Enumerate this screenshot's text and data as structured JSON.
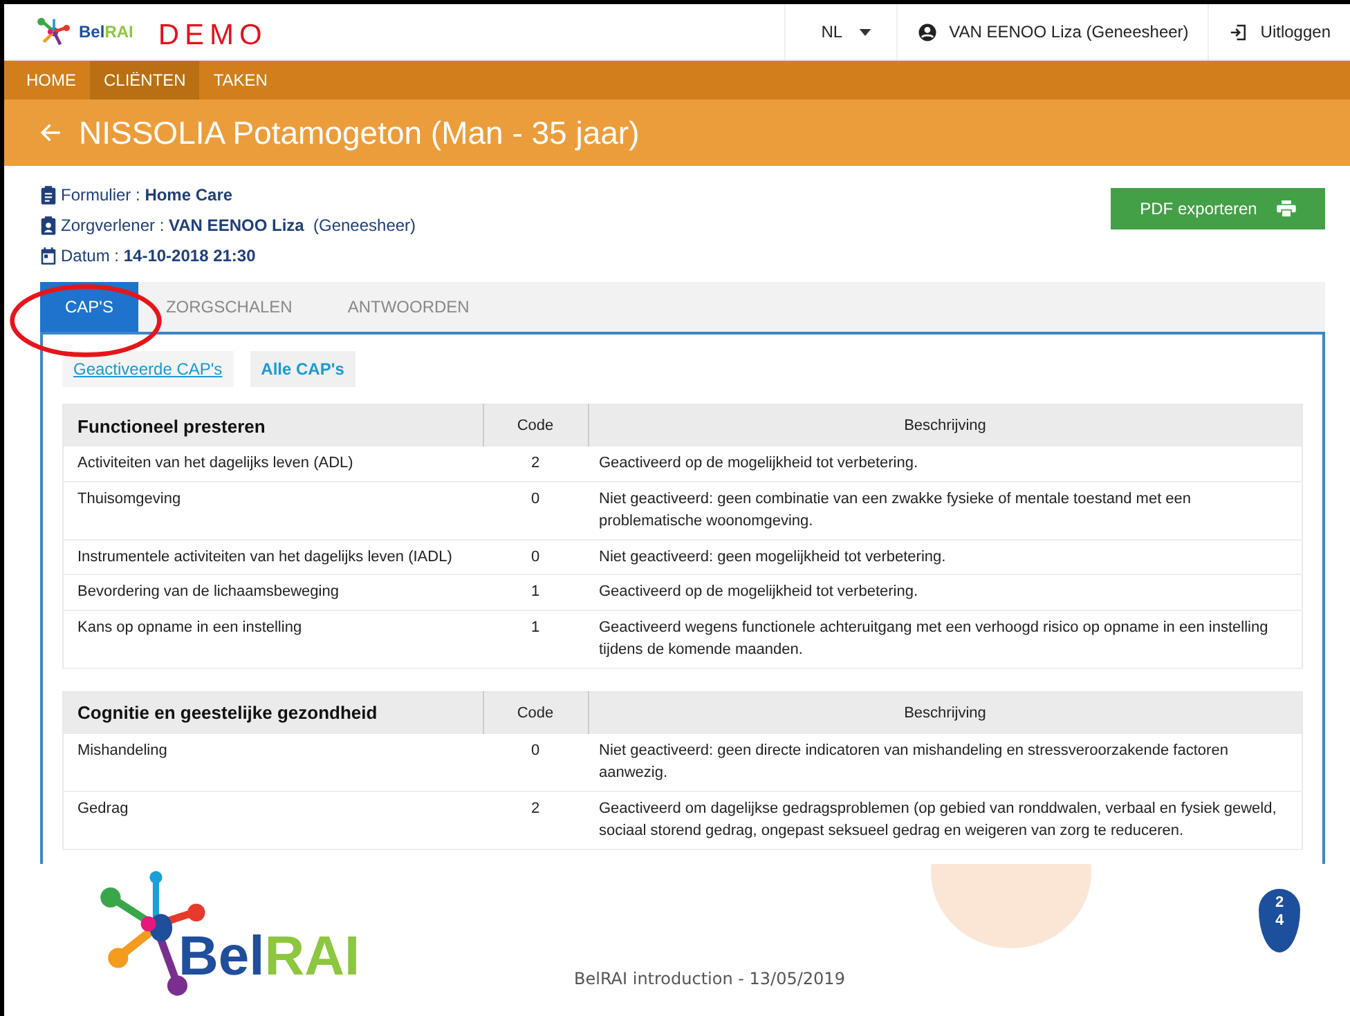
{
  "header": {
    "logo_first": "Bel",
    "logo_second": "RAI",
    "demo_label": "DEMO",
    "language": "NL",
    "user": "VAN EENOO Liza (Geneesheer)",
    "logout": "Uitloggen"
  },
  "nav": [
    {
      "label": "HOME",
      "selected": false
    },
    {
      "label": "CLIËNTEN",
      "selected": true
    },
    {
      "label": "TAKEN",
      "selected": false
    }
  ],
  "client_title": "NISSOLIA Potamogeton (Man - 35 jaar)",
  "info": [
    {
      "kind": "form",
      "label": "Formulier :",
      "value": "Home Care"
    },
    {
      "kind": "person",
      "label": "Zorgverlener :",
      "value": "VAN EENOO Liza",
      "extra": "(Geneesheer)"
    },
    {
      "kind": "date",
      "label": "Datum :",
      "value": "14-10-2018 21:30"
    }
  ],
  "export_button": "PDF exporteren",
  "tabs": [
    {
      "label": "CAP'S",
      "selected": true
    },
    {
      "label": "ZORGSCHALEN",
      "selected": false
    },
    {
      "label": "ANTWOORDEN",
      "selected": false
    }
  ],
  "subtabs": [
    {
      "label": "Geactiveerde CAP's",
      "selected": false
    },
    {
      "label": "Alle CAP's",
      "selected": true
    }
  ],
  "sections": [
    {
      "title": "Functioneel presteren",
      "code_header": "Code",
      "description_header": "Beschrijving",
      "rows": [
        {
          "name": "Activiteiten van het dagelijks leven (ADL)",
          "code": "2",
          "description": "Geactiveerd op de mogelijkheid tot verbetering."
        },
        {
          "name": "Thuisomgeving",
          "code": "0",
          "description": "Niet geactiveerd: geen combinatie van een zwakke fysieke of mentale toestand met een problematische woonomgeving."
        },
        {
          "name": "Instrumentele activiteiten van het dagelijks leven (IADL)",
          "code": "0",
          "description": "Niet geactiveerd: geen mogelijkheid tot verbetering."
        },
        {
          "name": "Bevordering van de lichaamsbeweging",
          "code": "1",
          "description": "Geactiveerd op de mogelijkheid tot verbetering."
        },
        {
          "name": "Kans op opname in een instelling",
          "code": "1",
          "description": "Geactiveerd wegens functionele achteruitgang met een verhoogd risico op opname in een instelling tijdens de komende maanden."
        }
      ]
    },
    {
      "title": "Cognitie en geestelijke gezondheid",
      "code_header": "Code",
      "description_header": "Beschrijving",
      "rows": [
        {
          "name": "Mishandeling",
          "code": "0",
          "description": "Niet geactiveerd: geen directe indicatoren van mishandeling en stressveroorzakende factoren aanwezig."
        },
        {
          "name": "Gedrag",
          "code": "2",
          "description": "Geactiveerd om dagelijkse gedragsproblemen (op gebied van ronddwalen, verbaal en fysiek geweld, sociaal storend gedrag, ongepast seksueel gedrag en weigeren van zorg te reduceren."
        }
      ]
    }
  ],
  "footer": {
    "logo_first": "Bel",
    "logo_second": "RAI",
    "caption": "BelRAI introduction - 13/05/2019",
    "page_number": "24"
  }
}
